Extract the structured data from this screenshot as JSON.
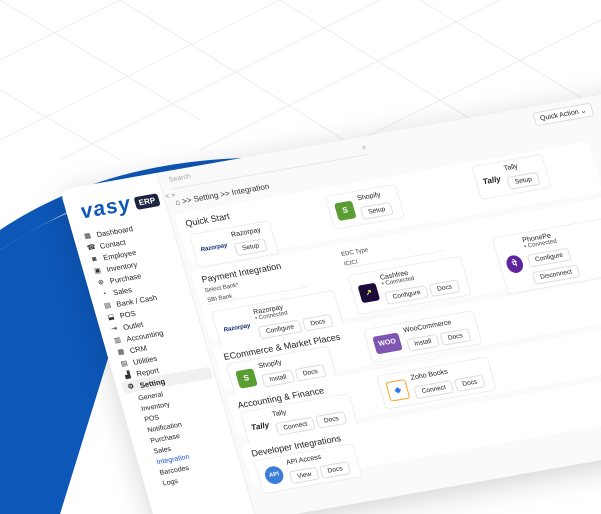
{
  "brand": {
    "name": "vasy",
    "badge": "ERP",
    "colors": {
      "primary": "#0d57b8",
      "dark": "#1b2540"
    }
  },
  "topbar": {
    "search_placeholder": "Search",
    "quick_action": "Quick Action ⌄",
    "collapse": "< >"
  },
  "breadcrumb": "⌂ >> Setting >> Integration",
  "sidebar": {
    "items": [
      {
        "icon": "grid-icon",
        "glyph": "▦",
        "label": "Dashboard"
      },
      {
        "icon": "contact-icon",
        "glyph": "☎",
        "label": "Contact"
      },
      {
        "icon": "employee-icon",
        "glyph": "◙",
        "label": "Employee"
      },
      {
        "icon": "inventory-icon",
        "glyph": "▣",
        "label": "Inventory"
      },
      {
        "icon": "cart-icon",
        "glyph": "⊕",
        "label": "Purchase"
      },
      {
        "icon": "sales-icon",
        "glyph": "◔",
        "label": "Sales"
      },
      {
        "icon": "bank-icon",
        "glyph": "▤",
        "label": "Bank / Cash"
      },
      {
        "icon": "pos-icon",
        "glyph": "⬓",
        "label": "POS"
      },
      {
        "icon": "outlet-icon",
        "glyph": "⇥",
        "label": "Outlet"
      },
      {
        "icon": "accounting-icon",
        "glyph": "▥",
        "label": "Accounting"
      },
      {
        "icon": "crm-icon",
        "glyph": "▦",
        "label": "CRM"
      },
      {
        "icon": "utilities-icon",
        "glyph": "▤",
        "label": "Utilities"
      },
      {
        "icon": "report-icon",
        "glyph": "▟",
        "label": "Report"
      },
      {
        "icon": "gear-icon",
        "glyph": "⚙",
        "label": "Setting"
      }
    ],
    "sub": [
      "General",
      "Inventory",
      "POS",
      "Notification",
      "Purchase",
      "Sales",
      "Integration",
      "Barcodes",
      "Logs"
    ]
  },
  "sections": {
    "quick_start": {
      "title": "Quick Start",
      "razorpay": {
        "name": "Razorpay",
        "btn": "Setup"
      },
      "shopify": {
        "name": "Shopify",
        "btn": "Setup"
      },
      "tally": {
        "name": "Tally",
        "btn": "Setup"
      }
    },
    "payment": {
      "title": "Payment Integration",
      "select_bank": "Select Bank*",
      "bank_value": "SBI Bank",
      "edc_type": "EDC Type",
      "edc_value": "ICICI",
      "razorpay": {
        "name": "Razorpay",
        "status": "• Connected",
        "btn1": "Configure",
        "btn2": "Docs"
      },
      "cashfree": {
        "name": "Cashfree",
        "status": "• Connected",
        "btn1": "Configure",
        "btn2": "Docs"
      },
      "phonepe": {
        "name": "PhonePe",
        "status": "• Connected",
        "btn1": "Configure",
        "btn2": "Disconnect"
      }
    },
    "ecommerce": {
      "title": "ECommerce & Market Places",
      "shopify": {
        "name": "Shopify",
        "btn1": "Install",
        "btn2": "Docs"
      },
      "woo": {
        "name": "WooCommerce",
        "logo": "WOO",
        "btn1": "Install",
        "btn2": "Docs"
      }
    },
    "accounting": {
      "title": "Accounting & Finance",
      "tally": {
        "name": "Tally",
        "btn1": "Connect",
        "btn2": "Docs"
      },
      "zoho": {
        "name": "Zoho Books",
        "btn1": "Connect",
        "btn2": "Docs"
      }
    },
    "developer": {
      "title": "Developer Integrations",
      "api": {
        "name": "API Access",
        "logo": "API",
        "btn1": "View",
        "btn2": "Docs"
      }
    }
  }
}
